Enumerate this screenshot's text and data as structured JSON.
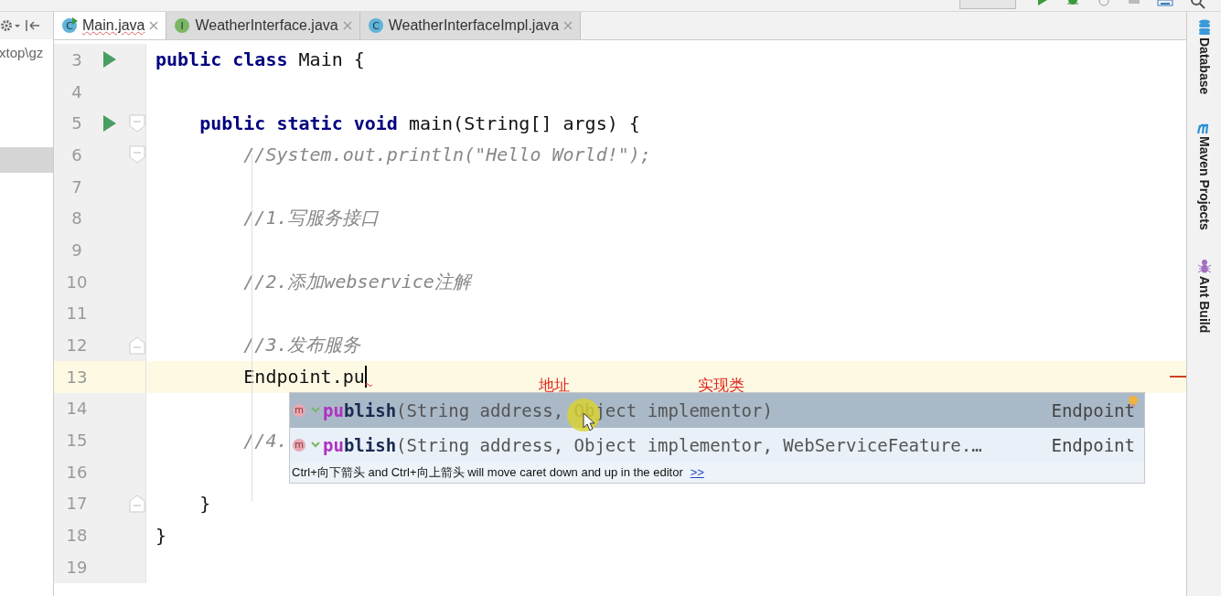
{
  "tabs": [
    {
      "label": "Main.java",
      "icon": "C",
      "kind": "class-run",
      "selected": true
    },
    {
      "label": "WeatherInterface.java",
      "icon": "I",
      "kind": "interface",
      "selected": false
    },
    {
      "label": "WeatherInterfaceImpl.java",
      "icon": "C",
      "kind": "class",
      "selected": false
    }
  ],
  "project_panel": {
    "path": "xtop\\gz"
  },
  "tool_windows": [
    {
      "label": "Database",
      "kind": "database"
    },
    {
      "label": "Maven Projects",
      "kind": "maven"
    },
    {
      "label": "Ant Build",
      "kind": "ant"
    }
  ],
  "lines": [
    {
      "number": "3",
      "run": true,
      "current": false,
      "segments": [
        {
          "kind": "keyword",
          "text": "public class "
        },
        {
          "kind": "plain",
          "text": "Main {"
        }
      ]
    },
    {
      "number": "4",
      "current": false
    },
    {
      "number": "5",
      "run": true,
      "fold_start": true,
      "current": false,
      "segments": [
        {
          "kind": "keyword",
          "text": "    public static void "
        },
        {
          "kind": "plain",
          "text": "main(String[] args) {"
        }
      ]
    },
    {
      "number": "6",
      "fold_start": true,
      "current": false,
      "segments": [
        {
          "kind": "comment",
          "text": "        //System.out.println(\"Hello World!\");"
        }
      ]
    },
    {
      "number": "7",
      "current": false
    },
    {
      "number": "8",
      "current": false,
      "segments": [
        {
          "kind": "comment",
          "text": "        //1.写服务接口"
        }
      ]
    },
    {
      "number": "9",
      "current": false
    },
    {
      "number": "10",
      "current": false,
      "segments": [
        {
          "kind": "comment",
          "text": "        //2.添加webservice注解"
        }
      ]
    },
    {
      "number": "11",
      "current": false
    },
    {
      "number": "12",
      "fold_end": true,
      "current": false,
      "segments": [
        {
          "kind": "comment",
          "text": "        //3.发布服务"
        }
      ]
    },
    {
      "number": "13",
      "current": true,
      "segments": [
        {
          "kind": "plain",
          "text": "        Endpoint.pu"
        }
      ]
    },
    {
      "number": "14",
      "current": false
    },
    {
      "number": "15",
      "current": false,
      "segments": [
        {
          "kind": "comment",
          "text": "        //4."
        }
      ]
    },
    {
      "number": "16",
      "current": false
    },
    {
      "number": "17",
      "fold_end": true,
      "current": false,
      "segments": [
        {
          "kind": "plain",
          "text": "    }"
        }
      ]
    },
    {
      "number": "18",
      "current": false,
      "segments": [
        {
          "kind": "plain",
          "text": "}"
        }
      ]
    },
    {
      "number": "19",
      "current": false
    }
  ],
  "annotations": [
    {
      "text": "地址"
    },
    {
      "text": "实现类"
    }
  ],
  "completion": {
    "items": [
      {
        "icon": "m",
        "match": "pu",
        "rest": "blish",
        "params": "(String address, Object implementor)",
        "type": "Endpoint",
        "selected": true
      },
      {
        "icon": "m",
        "match": "pu",
        "rest": "blish",
        "params": "(String address, Object implementor, WebServiceFeature.…",
        "type": "Endpoint",
        "selected": false
      }
    ],
    "hint": "Ctrl+向下箭头 and Ctrl+向上箭头 will move caret down and up in the editor",
    "hint_link": ">>"
  }
}
